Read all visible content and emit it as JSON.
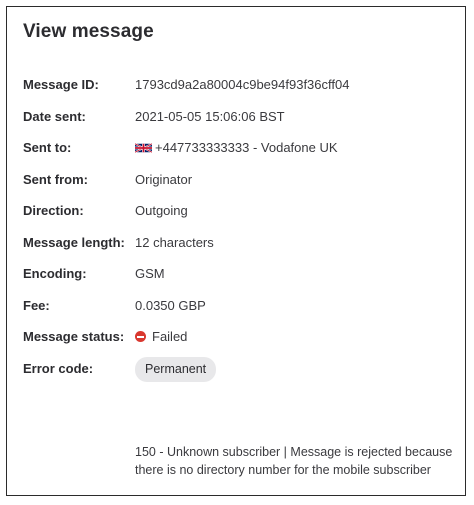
{
  "header": {
    "title": "View message"
  },
  "fields": {
    "message_id": {
      "label": "Message ID:",
      "value": "1793cd9a2a80004c9be94f93f36cff04"
    },
    "date_sent": {
      "label": "Date sent:",
      "value": "2021-05-05 15:06:06 BST"
    },
    "sent_to": {
      "label": "Sent to:",
      "value": "+447733333333 - Vodafone UK",
      "flag_icon": "uk-flag-icon"
    },
    "sent_from": {
      "label": "Sent from:",
      "value": "Originator"
    },
    "direction": {
      "label": "Direction:",
      "value": "Outgoing"
    },
    "message_length": {
      "label": "Message length:",
      "value": "12 characters"
    },
    "encoding": {
      "label": "Encoding:",
      "value": "GSM"
    },
    "fee": {
      "label": "Fee:",
      "value": "0.0350 GBP"
    },
    "message_status": {
      "label": "Message status:",
      "value": "Failed",
      "status_icon": "failed-icon",
      "status_color": "#d9382f"
    },
    "error_code": {
      "label": "Error code:",
      "badge": "Permanent",
      "description": "150 - Unknown subscriber | Message is rejected because there is no directory number for the mobile subscriber"
    }
  }
}
